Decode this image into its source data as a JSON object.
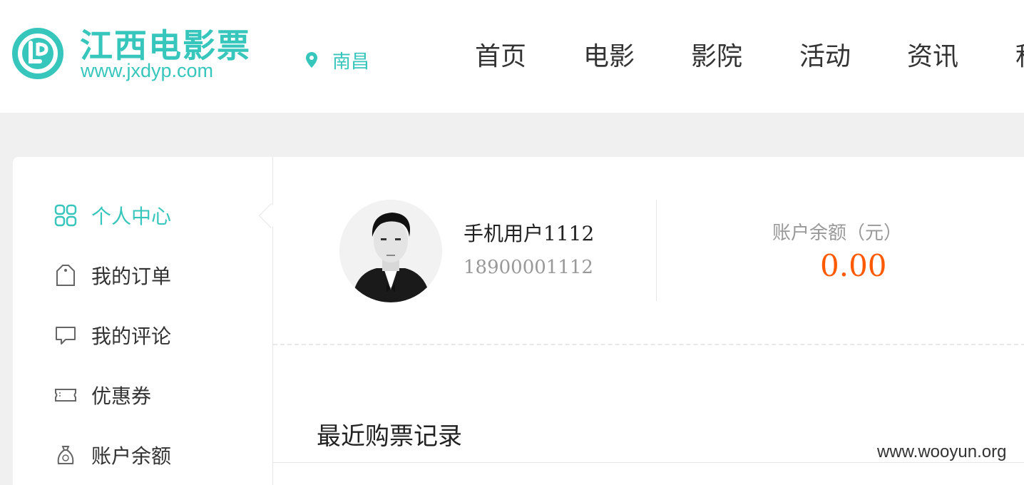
{
  "header": {
    "logo_title": "江西电影票",
    "logo_url": "www.jxdyp.com",
    "city": "南昌",
    "nav": [
      "首页",
      "电影",
      "影院",
      "活动",
      "资讯",
      "积"
    ]
  },
  "sidebar": {
    "items": [
      {
        "label": "个人中心",
        "icon": "grid-icon"
      },
      {
        "label": "我的订单",
        "icon": "tag-icon"
      },
      {
        "label": "我的评论",
        "icon": "comment-icon"
      },
      {
        "label": "优惠券",
        "icon": "ticket-icon"
      },
      {
        "label": "账户余额",
        "icon": "moneybag-icon"
      }
    ]
  },
  "profile": {
    "name": "手机用户1112",
    "phone": "18900001112",
    "balance_label": "账户余额（元）",
    "balance_value": "0.00"
  },
  "recent": {
    "title": "最近购票记录"
  },
  "watermark": "www.wooyun.org",
  "colors": {
    "accent": "#37c6bc",
    "balance": "#ff5a00",
    "background": "#f0f0f0"
  }
}
